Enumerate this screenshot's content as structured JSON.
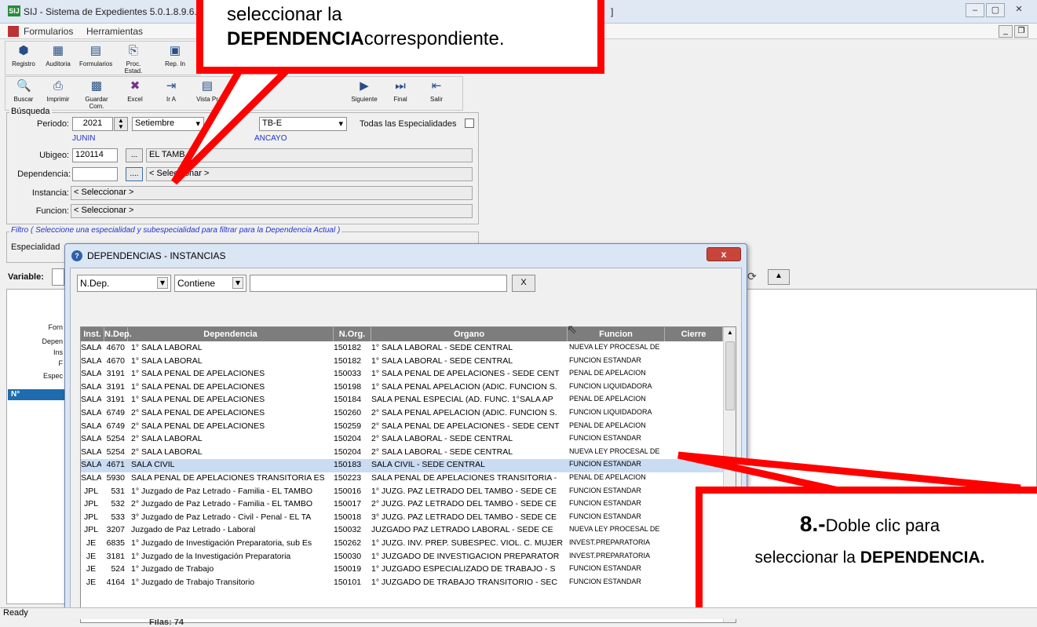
{
  "window": {
    "title": "SIJ - Sistema de Expedientes 5.0.1.8.9.6.3",
    "title_suffix": "]"
  },
  "menu": {
    "items": [
      "Formularios",
      "Herramientas"
    ]
  },
  "toolbar1": [
    "Registro",
    "Auditoria",
    "Formularios",
    "Proc. Estad.",
    "Rep. In"
  ],
  "toolbar2": [
    "Buscar",
    "Imprimir",
    "Guardar Com.",
    "Excel",
    "Ir A",
    "Vista Pr",
    "Siguiente",
    "Final",
    "Salir"
  ],
  "busqueda": {
    "group_label": "Búsqueda",
    "periodo_label": "Periodo:",
    "year": "2021",
    "month": "Setiembre",
    "f_prefix": "F",
    "code": "TB-E",
    "todas_label": "Todas las Especialidades",
    "region": "JUNIN",
    "province": "ANCAYO",
    "ubigeo_label": "Ubigeo:",
    "ubigeo": "120114",
    "ubigeo_btn": "...",
    "ubigeo_name": "EL TAMB",
    "dependencia_label": "Dependencia:",
    "dependencia_btn": "....",
    "dependencia_value": "< Seleccionar >",
    "instancia_label": "Instancia:",
    "instancia_value": "< Seleccionar >",
    "funcion_label": "Funcion:",
    "funcion_value": "< Seleccionar >"
  },
  "filtro": {
    "label": "Filtro ( Seleccione una especialidad y subespecialidad para filtrar para la Dependencia Actual )",
    "especialidad_label": "Especialidad"
  },
  "variable_label": "Variable:",
  "side_labels": [
    "Forn",
    "Depen",
    "Ins",
    "F",
    "Espec"
  ],
  "side_col": "N°",
  "dialog": {
    "title": "DEPENDENCIAS - INSTANCIAS",
    "close": "x",
    "field": "N.Dep.",
    "operator": "Contiene",
    "search": "",
    "clear": "X",
    "columns": [
      "Inst.",
      "N.Dep.",
      "Dependencia",
      "N.Org.",
      "Organo",
      "Funcion",
      "Cierre"
    ],
    "rows": [
      [
        "SALA",
        "4670",
        "1° SALA LABORAL",
        "150182",
        "1° SALA LABORAL - SEDE CENTRAL",
        "NUEVA LEY PROCESAL DE",
        ""
      ],
      [
        "SALA",
        "4670",
        "1° SALA LABORAL",
        "150182",
        "1° SALA LABORAL - SEDE CENTRAL",
        "FUNCION ESTANDAR",
        ""
      ],
      [
        "SALA",
        "3191",
        "1° SALA PENAL DE APELACIONES",
        "150033",
        "1° SALA PENAL DE APELACIONES  - SEDE CENT",
        "PENAL DE APELACION",
        ""
      ],
      [
        "SALA",
        "3191",
        "1° SALA PENAL DE APELACIONES",
        "150198",
        "1° SALA PENAL APELACION (ADIC. FUNCION S.",
        "FUNCION LIQUIDADORA",
        ""
      ],
      [
        "SALA",
        "3191",
        "1° SALA PENAL DE APELACIONES",
        "150184",
        "SALA PENAL ESPECIAL (AD. FUNC. 1°SALA AP",
        "PENAL DE APELACION",
        ""
      ],
      [
        "SALA",
        "6749",
        "2° SALA PENAL DE APELACIONES",
        "150260",
        "2° SALA PENAL APELACION (ADIC. FUNCION S.",
        "FUNCION LIQUIDADORA",
        ""
      ],
      [
        "SALA",
        "6749",
        "2° SALA PENAL DE APELACIONES",
        "150259",
        "2° SALA PENAL DE APELACIONES  - SEDE CENT",
        "PENAL DE APELACION",
        ""
      ],
      [
        "SALA",
        "5254",
        "2° SALA LABORAL",
        "150204",
        "2° SALA LABORAL - SEDE CENTRAL",
        "FUNCION ESTANDAR",
        ""
      ],
      [
        "SALA",
        "5254",
        "2° SALA LABORAL",
        "150204",
        "2° SALA LABORAL - SEDE CENTRAL",
        "NUEVA LEY PROCESAL DE",
        ""
      ],
      [
        "SALA",
        "4671",
        "SALA CIVIL",
        "150183",
        "SALA CIVIL - SEDE CENTRAL",
        "FUNCION ESTANDAR",
        ""
      ],
      [
        "SALA",
        "5930",
        "SALA PENAL DE APELACIONES TRANSITORIA ES",
        "150223",
        "SALA PENAL DE APELACIONES TRANSITORIA -",
        "PENAL DE APELACION",
        ""
      ],
      [
        "JPL",
        "531",
        "1° Juzgado de Paz Letrado - Familia - EL TAMBO",
        "150016",
        "1° JUZG. PAZ LETRADO DEL TAMBO - SEDE CE",
        "FUNCION ESTANDAR",
        ""
      ],
      [
        "JPL",
        "532",
        "2° Juzgado de Paz Letrado - Familia - EL TAMBO",
        "150017",
        "2° JUZG. PAZ LETRADO DEL TAMBO - SEDE CE",
        "FUNCION ESTANDAR",
        ""
      ],
      [
        "JPL",
        "533",
        "3° Juzgado de Paz Letrado - Civil - Penal - EL TA",
        "150018",
        "3° JUZG. PAZ LETRADO DEL TAMBO - SEDE CE",
        "FUNCION ESTANDAR",
        ""
      ],
      [
        "JPL",
        "3207",
        "Juzgado de Paz Letrado - Laboral",
        "150032",
        "JUZGADO PAZ LETRADO LABORAL - SEDE CE",
        "NUEVA LEY PROCESAL DE",
        ""
      ],
      [
        "JE",
        "6835",
        "1° Juzgado de Investigación Preparatoria, sub Es",
        "150262",
        "1° JUZG. INV. PREP. SUBESPEC. VIOL. C. MUJER",
        "INVEST.PREPARATORIA",
        ""
      ],
      [
        "JE",
        "3181",
        "1° Juzgado de la Investigación Preparatoria",
        "150030",
        "1° JUZGADO DE INVESTIGACION PREPARATOR",
        "INVEST.PREPARATORIA",
        ""
      ],
      [
        "JE",
        "524",
        "1° Juzgado de Trabajo",
        "150019",
        "1° JUZGADO ESPECIALIZADO DE TRABAJO - S",
        "FUNCION ESTANDAR",
        ""
      ],
      [
        "JE",
        "4164",
        "1° Juzgado de Trabajo Transitorio",
        "150101",
        "1° JUZGADO DE TRABAJO TRANSITORIO - SEC",
        "FUNCION ESTANDAR",
        ""
      ]
    ],
    "selected_row": 9,
    "filas": "Filas: 74"
  },
  "callout_top": {
    "line1": "seleccionar la",
    "line2_bold": "DEPENDENCIA",
    "line2_rest": "correspondiente."
  },
  "callout_bottom": {
    "num": "8.-",
    "text1": "Doble clic para",
    "text2": "seleccionar la ",
    "bold": "DEPENDENCIA."
  },
  "status": "Ready",
  "colors": {
    "callout_border": "#ff0000",
    "grid_header": "#7d7d7d",
    "selected_row": "#c9dcf2"
  }
}
